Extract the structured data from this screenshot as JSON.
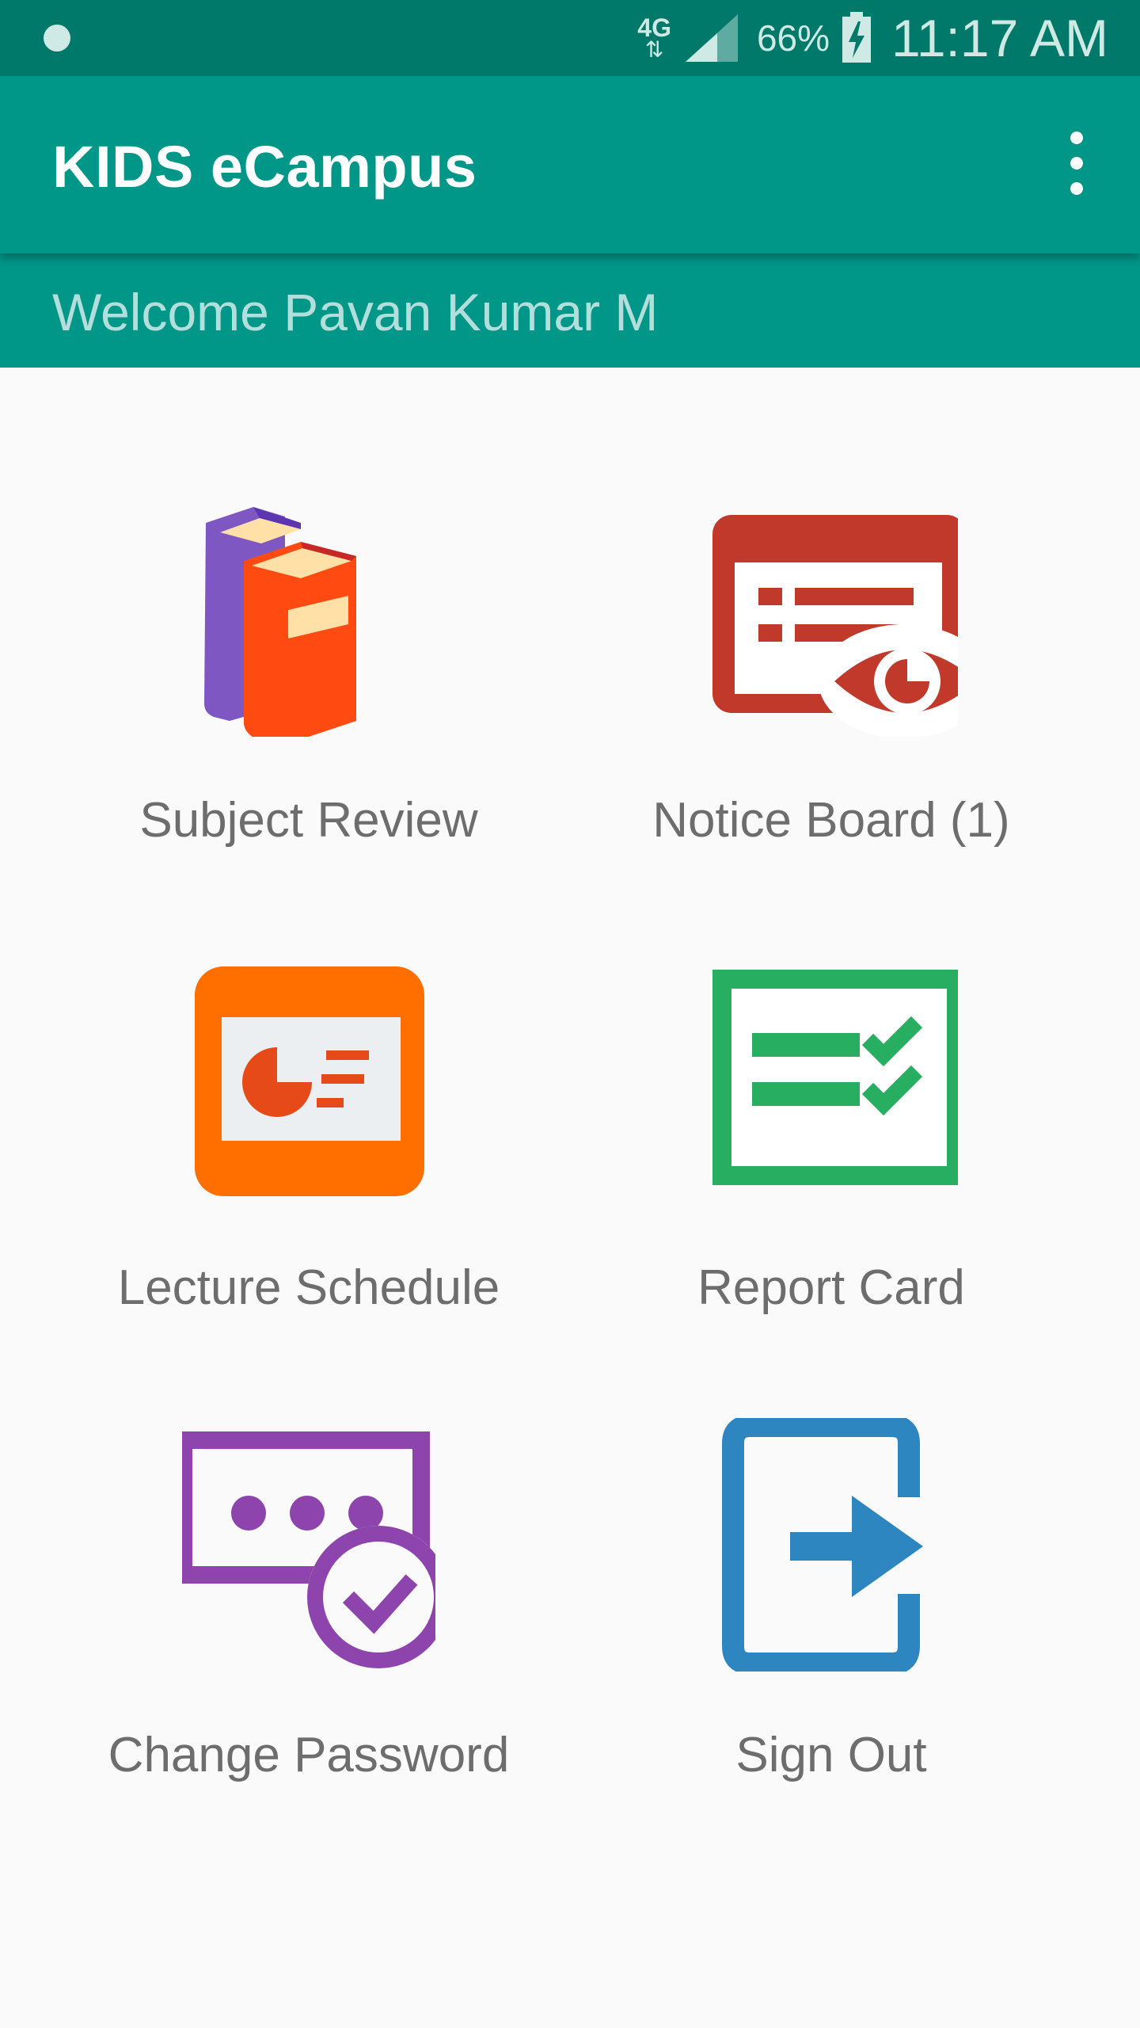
{
  "status_bar": {
    "network_type": "4G",
    "network_arrows": "⇅",
    "battery_percent": "66%",
    "time": "11:17 AM"
  },
  "app_bar": {
    "title": "KIDS eCampus",
    "menu_icon": "more-vert-icon"
  },
  "welcome": {
    "text": "Welcome Pavan Kumar M"
  },
  "colors": {
    "status_bar": "#00796b",
    "primary": "#009688",
    "background": "#fafafa"
  },
  "menu": {
    "items": [
      {
        "label": "Subject Review",
        "icon": "books-icon"
      },
      {
        "label": "Notice Board (1)",
        "icon": "notice-board-icon"
      },
      {
        "label": "Lecture Schedule",
        "icon": "presentation-icon"
      },
      {
        "label": "Report Card",
        "icon": "report-card-icon"
      },
      {
        "label": "Change Password",
        "icon": "password-check-icon"
      },
      {
        "label": "Sign Out",
        "icon": "sign-out-icon"
      }
    ]
  }
}
